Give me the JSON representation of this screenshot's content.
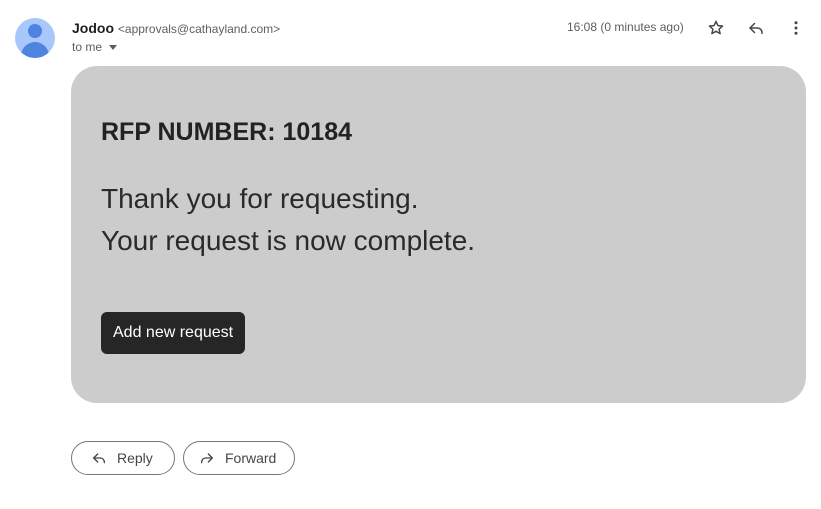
{
  "email": {
    "sender_name": "Jodoo",
    "sender_email": "<approvals@cathayland.com>",
    "recipient": "to me",
    "timestamp": "16:08 (0 minutes ago)"
  },
  "header_actions": {
    "star_icon": "star-outline-icon",
    "reply_icon": "reply-arrow-icon",
    "more_icon": "more-vertical-icon"
  },
  "body": {
    "rfp_heading": "RFP NUMBER: 10184",
    "message_line_1": "Thank you for requesting.",
    "message_line_2": "Your request is now complete.",
    "button_label": "Add new request"
  },
  "footer": {
    "reply_label": "Reply",
    "forward_label": "Forward"
  },
  "colors": {
    "card_background": "#cccccc",
    "button_background": "#262626",
    "avatar_background": "#a8c7fa",
    "avatar_figure": "#4f83e0"
  }
}
